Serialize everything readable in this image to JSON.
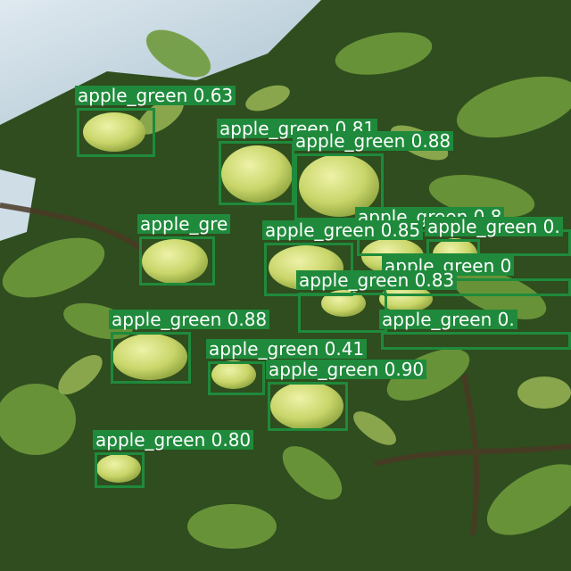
{
  "image": {
    "subject": "green apples on tree branches"
  },
  "colors": {
    "box": "#1f8a3b",
    "label_text": "#ffffff",
    "sky": "#cfe0ea",
    "apple": "#c9d66a"
  },
  "detections": [
    {
      "label": "apple_green 0.63"
    },
    {
      "label": "apple_green 0.81"
    },
    {
      "label": "apple_green 0.88"
    },
    {
      "label": "apple_green 0.8"
    },
    {
      "label": "apple_green 0.85"
    },
    {
      "label": "apple_green 0."
    },
    {
      "label": "apple_green 0"
    },
    {
      "label": "apple_green 0.83"
    },
    {
      "label": "apple_green 0."
    },
    {
      "label": "apple_green 0.88"
    },
    {
      "label": "apple_green 0.41"
    },
    {
      "label": "apple_green 0.90"
    },
    {
      "label": "apple_green 0.80"
    },
    {
      "label": "apple_gre"
    }
  ]
}
